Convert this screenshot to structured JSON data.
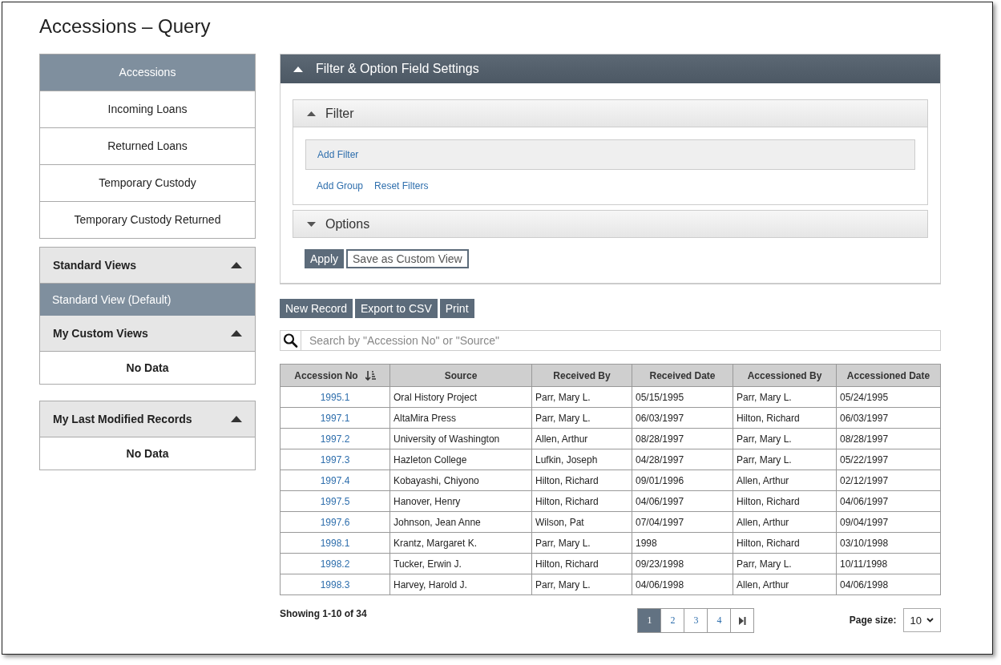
{
  "page": {
    "title": "Accessions – Query"
  },
  "nav": [
    {
      "label": "Accessions",
      "selected": true
    },
    {
      "label": "Incoming Loans",
      "selected": false
    },
    {
      "label": "Returned Loans",
      "selected": false
    },
    {
      "label": "Temporary Custody",
      "selected": false
    },
    {
      "label": "Temporary Custody Returned",
      "selected": false
    }
  ],
  "views": {
    "sections": [
      {
        "title": "Standard Views",
        "expanded": true,
        "items": [
          {
            "label": "Standard View (Default)",
            "selected": true
          }
        ]
      },
      {
        "title": "My Custom Views",
        "expanded": true,
        "empty_text": "No Data"
      }
    ]
  },
  "last_modified": {
    "title": "My Last Modified Records",
    "expanded": true,
    "empty_text": "No Data"
  },
  "settings": {
    "title": "Filter & Option Field Settings",
    "expanded": true,
    "filter": {
      "title": "Filter",
      "expanded": true,
      "add_filter": "Add Filter",
      "links": [
        "Add Group",
        "Reset Filters"
      ]
    },
    "options": {
      "title": "Options",
      "expanded": false
    },
    "apply": "Apply",
    "save": "Save as Custom View"
  },
  "toolbar": [
    "New Record",
    "Export to CSV",
    "Print"
  ],
  "search": {
    "placeholder": "Search by \"Accession No\" or \"Source\""
  },
  "table": {
    "columns": [
      {
        "label": "Accession No",
        "sorted": true
      },
      {
        "label": "Source",
        "sorted": false
      },
      {
        "label": "Received By",
        "sorted": false
      },
      {
        "label": "Received Date",
        "sorted": false
      },
      {
        "label": "Accessioned By",
        "sorted": false
      },
      {
        "label": "Accessioned Date",
        "sorted": false
      }
    ],
    "rows": [
      [
        "1995.1",
        "Oral History Project",
        "Parr, Mary L.",
        "05/15/1995",
        "Parr, Mary L.",
        "05/24/1995"
      ],
      [
        "1997.1",
        "AltaMira Press",
        "Parr, Mary L.",
        "06/03/1997",
        "Hilton, Richard",
        "06/03/1997"
      ],
      [
        "1997.2",
        "University of Washington",
        "Allen, Arthur",
        "08/28/1997",
        "Parr, Mary L.",
        "08/28/1997"
      ],
      [
        "1997.3",
        "Hazleton College",
        "Lufkin, Joseph",
        "04/28/1997",
        "Parr, Mary L.",
        "05/22/1997"
      ],
      [
        "1997.4",
        "Kobayashi, Chiyono",
        "Hilton, Richard",
        "09/01/1996",
        "Allen, Arthur",
        "02/12/1997"
      ],
      [
        "1997.5",
        "Hanover, Henry",
        "Hilton, Richard",
        "04/06/1997",
        "Hilton, Richard",
        "04/06/1997"
      ],
      [
        "1997.6",
        "Johnson, Jean Anne",
        "Wilson, Pat",
        "07/04/1997",
        "Allen, Arthur",
        "09/04/1997"
      ],
      [
        "1998.1",
        "Krantz, Margaret K.",
        "Parr, Mary L.",
        "1998",
        "Hilton, Richard",
        "03/10/1998"
      ],
      [
        "1998.2",
        "Tucker, Erwin J.",
        "Hilton, Richard",
        "09/23/1998",
        "Parr, Mary L.",
        "10/11/1998"
      ],
      [
        "1998.3",
        "Harvey, Harold J.",
        "Parr, Mary L.",
        "04/06/1998",
        "Allen, Arthur",
        "04/06/1998"
      ]
    ]
  },
  "pager": {
    "summary": "Showing 1-10 of 34",
    "pages": [
      {
        "label": "1",
        "selected": true
      },
      {
        "label": "2",
        "selected": false
      },
      {
        "label": "3",
        "selected": false
      },
      {
        "label": "4",
        "selected": false
      }
    ],
    "page_size_label": "Page size:",
    "page_size": "10"
  }
}
